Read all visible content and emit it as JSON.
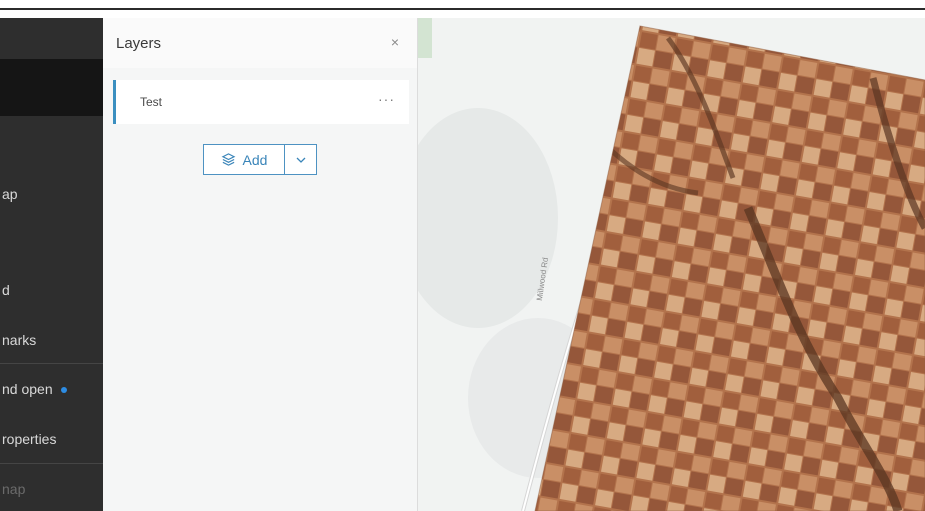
{
  "sidebar": {
    "items": [
      {
        "label": "ap"
      },
      {
        "label": "d"
      },
      {
        "label": "narks"
      },
      {
        "label": "nd open"
      },
      {
        "label": "roperties"
      },
      {
        "label": "nap"
      }
    ]
  },
  "layers_panel": {
    "title": "Layers",
    "close_icon": "×",
    "layers": [
      {
        "name": "Test",
        "more_icon": "···"
      }
    ],
    "add_button_label": "Add"
  },
  "map": {
    "road_label": "Millwood Rd"
  },
  "colors": {
    "sidebar_bg": "#2e2e2e",
    "accent": "#3b8fc0",
    "status_dot": "#2d8ce3"
  }
}
